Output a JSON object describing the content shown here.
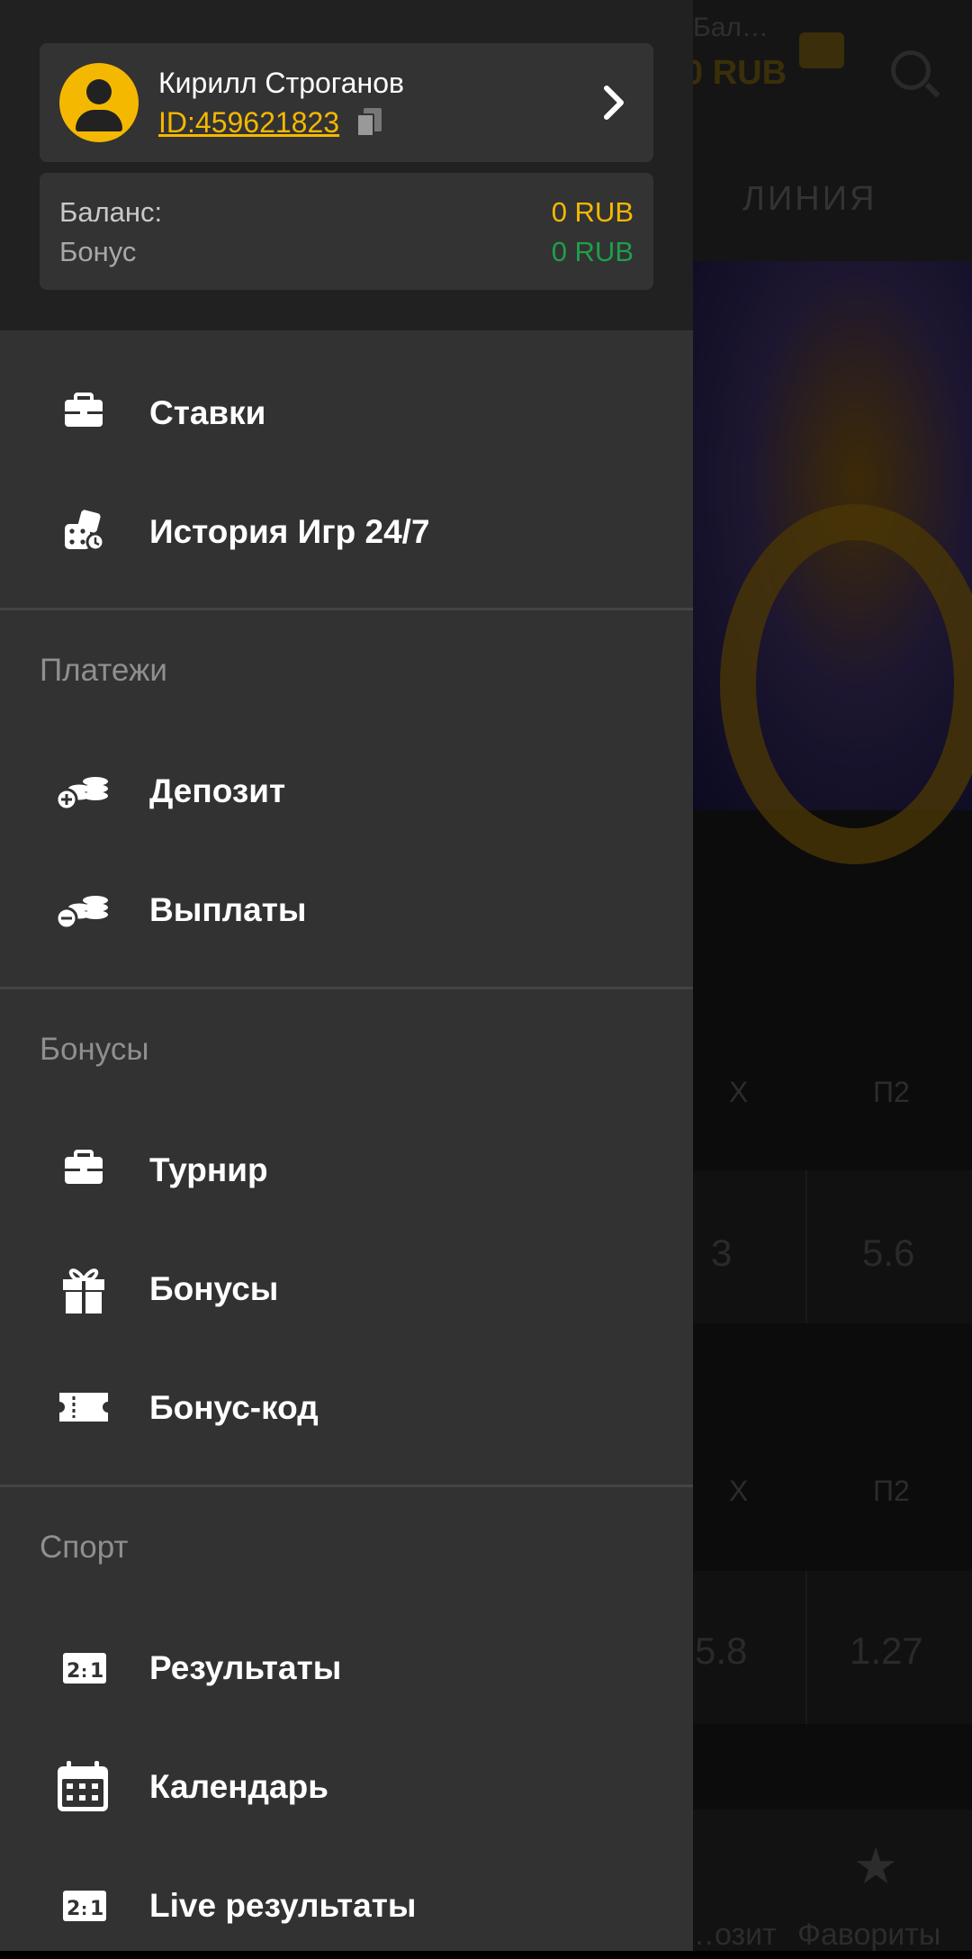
{
  "background": {
    "balance_label": "Бал…",
    "balance_value": "0 RUB",
    "tab_label": "ЛИНИЯ",
    "odds_rows": [
      {
        "headers": [
          "X",
          "П2"
        ],
        "values": [
          "3",
          "5.6"
        ]
      },
      {
        "headers": [
          "X",
          "П2"
        ],
        "values": [
          "5.8",
          "1.27"
        ]
      }
    ],
    "bottom_nav": [
      "…озит",
      "Фавориты"
    ]
  },
  "profile": {
    "name": "Кирилл Строганов",
    "id": "ID:459621823"
  },
  "balance": {
    "balance_label": "Баланс:",
    "balance_value": "0 RUB",
    "bonus_label": "Бонус",
    "bonus_value": "0 RUB"
  },
  "menu": {
    "top": [
      {
        "label": "Ставки",
        "icon": "briefcase-icon"
      },
      {
        "label": "История Игр 24/7",
        "icon": "dice-icon"
      }
    ],
    "payments": {
      "title": "Платежи",
      "items": [
        {
          "label": "Депозит",
          "icon": "coins-plus-icon"
        },
        {
          "label": "Выплаты",
          "icon": "coins-minus-icon"
        }
      ]
    },
    "bonuses": {
      "title": "Бонусы",
      "items": [
        {
          "label": "Турнир",
          "icon": "briefcase-icon"
        },
        {
          "label": "Бонусы",
          "icon": "gift-icon"
        },
        {
          "label": "Бонус-код",
          "icon": "ticket-icon"
        }
      ]
    },
    "sport": {
      "title": "Спорт",
      "items": [
        {
          "label": "Результаты",
          "icon": "scoreboard-icon"
        },
        {
          "label": "Календарь",
          "icon": "calendar-icon"
        },
        {
          "label": "Live результаты",
          "icon": "scoreboard-icon"
        }
      ]
    }
  },
  "colors": {
    "accent": "#f5b800",
    "bonus_green": "#1f9e4a",
    "drawer_bg": "#323232",
    "header_bg": "#212121"
  }
}
